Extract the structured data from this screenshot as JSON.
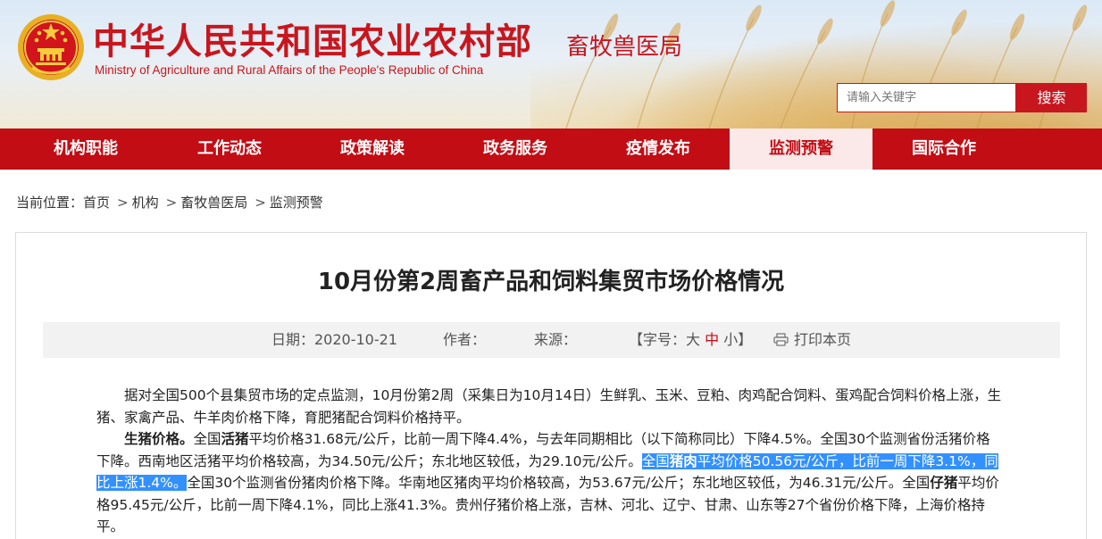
{
  "header": {
    "title_cn": "中华人民共和国农业农村部",
    "title_en": "Ministry of Agriculture and Rural Affairs of the People's Republic of China",
    "department": "畜牧兽医局",
    "emblem_icon": "national-emblem-icon"
  },
  "search": {
    "placeholder": "请输入关键字",
    "button_label": "搜索"
  },
  "nav": {
    "items": [
      {
        "label": "机构职能"
      },
      {
        "label": "工作动态"
      },
      {
        "label": "政策解读"
      },
      {
        "label": "政务服务"
      },
      {
        "label": "疫情发布"
      },
      {
        "label": "监测预警",
        "active": true
      },
      {
        "label": "国际合作"
      }
    ]
  },
  "breadcrumb": {
    "prefix": "当前位置：",
    "items": [
      "首页",
      "机构",
      "畜牧兽医局",
      "监测预警"
    ],
    "separator": ">"
  },
  "article": {
    "title": "10月份第2周畜产品和饲料集贸市场价格情况",
    "meta": {
      "date_label": "日期：2020-10-21",
      "author_label": "作者：",
      "source_label": "来源：",
      "font_size_label": "【字号：",
      "size_large": "大",
      "size_medium": "中",
      "size_small": "小",
      "font_size_close": "】",
      "print_label": "打印本页"
    },
    "paragraphs": {
      "p1": "据对全国500个县集贸市场的定点监测，10月份第2周（采集日为10月14日）生鲜乳、玉米、豆粕、肉鸡配合饲料、蛋鸡配合饲料价格上涨，生猪、家禽产品、牛羊肉价格下降，育肥猪配合饲料价格持平。",
      "p2_head": "生猪价格。",
      "p2_a": "全国",
      "p2_b": "活猪",
      "p2_c": "平均价格31.68元/公斤，比前一周下降4.4%，与去年同期相比（以下简称同比）下降4.5%。全国30个监测省份活猪价格下降。西南地区活猪平均价格较高，为34.50元/公斤；东北地区较低，为29.10元/公斤。",
      "p2_hl_a": "全国",
      "p2_hl_b": "猪肉",
      "p2_hl_c": "平均价格50.56元/公斤，比前一周下降3.1%，同比上涨1.4%。",
      "p2_d": "全国30个监测省份猪肉价格下降。华南地区猪肉平均价格较高，为53.67元/公斤；东北地区较低，为46.31元/公斤。全国",
      "p2_e": "仔猪",
      "p2_f": "平均价格95.45元/公斤，比前一周下降4.1%，同比上涨41.3%。贵州仔猪价格上涨，吉林、河北、辽宁、甘肃、山东等27个省份价格下降，上海价格持平。"
    }
  },
  "colors": {
    "brand_red": "#c20d15",
    "highlight": "#3390ff"
  }
}
